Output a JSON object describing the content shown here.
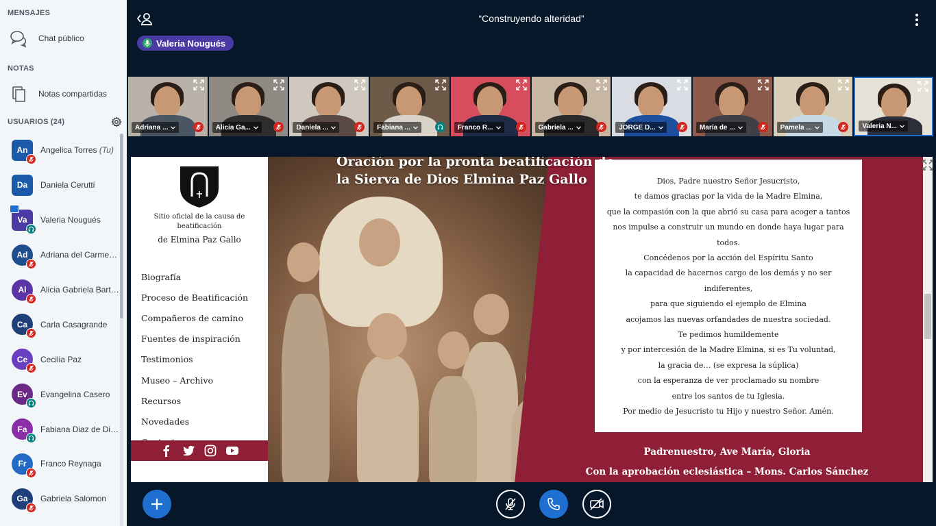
{
  "sidebar": {
    "messages_title": "MENSAJES",
    "public_chat": "Chat público",
    "notes_title": "NOTAS",
    "shared_notes": "Notas compartidas",
    "users_title": "USUARIOS (24)",
    "users": [
      {
        "initials": "An",
        "name": "Angelica Torres",
        "suffix": "(Tu)",
        "color": "#1a5aa8",
        "status": "muted",
        "shape": "square"
      },
      {
        "initials": "Da",
        "name": "Daniela Cerutti",
        "suffix": "",
        "color": "#1a5aa8",
        "status": "none",
        "shape": "square"
      },
      {
        "initials": "Va",
        "name": "Valeria Nougués",
        "suffix": "",
        "color": "#4a3aa3",
        "status": "listen",
        "shape": "square",
        "presenter": true
      },
      {
        "initials": "Ad",
        "name": "Adriana del Carmen Vill...",
        "suffix": "",
        "color": "#1f4e8c",
        "status": "muted",
        "shape": "round"
      },
      {
        "initials": "Al",
        "name": "Alicia Gabriela Bartolini",
        "suffix": "",
        "color": "#5b34a8",
        "status": "muted",
        "shape": "round"
      },
      {
        "initials": "Ca",
        "name": "Carla Casagrande",
        "suffix": "",
        "color": "#1f3f7a",
        "status": "muted",
        "shape": "round"
      },
      {
        "initials": "Ce",
        "name": "Cecilia Paz",
        "suffix": "",
        "color": "#6a3fbf",
        "status": "muted",
        "shape": "round"
      },
      {
        "initials": "Ev",
        "name": "Evangelina Casero",
        "suffix": "",
        "color": "#6b2a86",
        "status": "listen",
        "shape": "round"
      },
      {
        "initials": "Fa",
        "name": "Fabiana Diaz de Dinardi",
        "suffix": "",
        "color": "#8a2fa8",
        "status": "listen",
        "shape": "round"
      },
      {
        "initials": "Fr",
        "name": "Franco Reynaga",
        "suffix": "",
        "color": "#2469c4",
        "status": "muted",
        "shape": "round"
      },
      {
        "initials": "Ga",
        "name": "Gabriela Salomon",
        "suffix": "",
        "color": "#1f3f7a",
        "status": "muted",
        "shape": "round"
      }
    ]
  },
  "header": {
    "title": "“Construyendo alteridad”",
    "talking": "Valeria Nougués"
  },
  "videos": [
    {
      "label": "Adriana ...",
      "status": "muted",
      "bg": "#b9b2a8",
      "shirt": "#4b5663"
    },
    {
      "label": "Alicia Ga...",
      "status": "muted",
      "bg": "#8f8a83",
      "shirt": "#2d2d2d"
    },
    {
      "label": "Daniela ...",
      "status": "muted",
      "bg": "#cfc8bf",
      "shirt": "#5b4a43"
    },
    {
      "label": "Fabiana ...",
      "status": "listen",
      "bg": "#6e5a48",
      "shirt": "#d8d2c8"
    },
    {
      "label": "Franco R...",
      "status": "muted",
      "bg": "#d84d5e",
      "shirt": "#1f2a44"
    },
    {
      "label": "Gabriela ...",
      "status": "muted",
      "bg": "#c7b6a3",
      "shirt": "#2a2a2a"
    },
    {
      "label": "JORGE D...",
      "status": "muted",
      "bg": "#d9dde3",
      "shirt": "#1d4f9e"
    },
    {
      "label": "María de ...",
      "status": "muted",
      "bg": "#8b5a4a",
      "shirt": "#3f3f48"
    },
    {
      "label": "Pamela ...",
      "status": "muted",
      "bg": "#d8cdb6",
      "shirt": "#c8d9e6"
    },
    {
      "label": "Valeria N...",
      "status": "none",
      "bg": "#e7e2d8",
      "shirt": "#2c2f3a",
      "active": true
    }
  ],
  "slide": {
    "site_lines": [
      "Sitio oficial de la causa de",
      "beatificación"
    ],
    "site_name": "de Elmina Paz Gallo",
    "nav": [
      "Biografía",
      "Proceso de Beatificación",
      "Compañeros de camino",
      "Fuentes de inspiración",
      "Testimonios",
      "Museo – Archivo",
      "Recursos",
      "Novedades",
      "Contacto"
    ],
    "title_lines": [
      "Oración por la pronta beatificación de",
      "la Sierva de Dios Elmina Paz Gallo"
    ],
    "prayer": [
      "Dios, Padre nuestro Señor Jesucristo,",
      "te damos gracias por la vida de la Madre Elmina,",
      "que la compasión con la que abrió su casa para acoger a tantos",
      "nos impulse a construir un mundo en donde haya lugar para",
      "todos.",
      "Concédenos por la acción del Espíritu Santo",
      "la capacidad de hacernos cargo de los demás y no ser",
      "indiferentes,",
      "para que siguiendo el ejemplo de Elmina",
      "acojamos las nuevas orfandades de nuestra sociedad.",
      "Te pedimos humildemente",
      "y por intercesión de la Madre Elmina, si es Tu voluntad,",
      "la gracia de… (se expresa la súplica)",
      "con la esperanza de ver proclamado su nombre",
      "entre los santos de tu Iglesia.",
      "Por medio de Jesucristo tu Hijo y nuestro Señor. Amén."
    ],
    "footer": [
      "Padrenuestro, Ave María, Gloria",
      "Con la aprobación eclesiástica – Mons. Carlos Sánchez"
    ]
  },
  "colors": {
    "accent": "#1f6fd1",
    "muted": "#d1261e",
    "listen": "#008081",
    "slide_bg": "#8e1f36"
  }
}
